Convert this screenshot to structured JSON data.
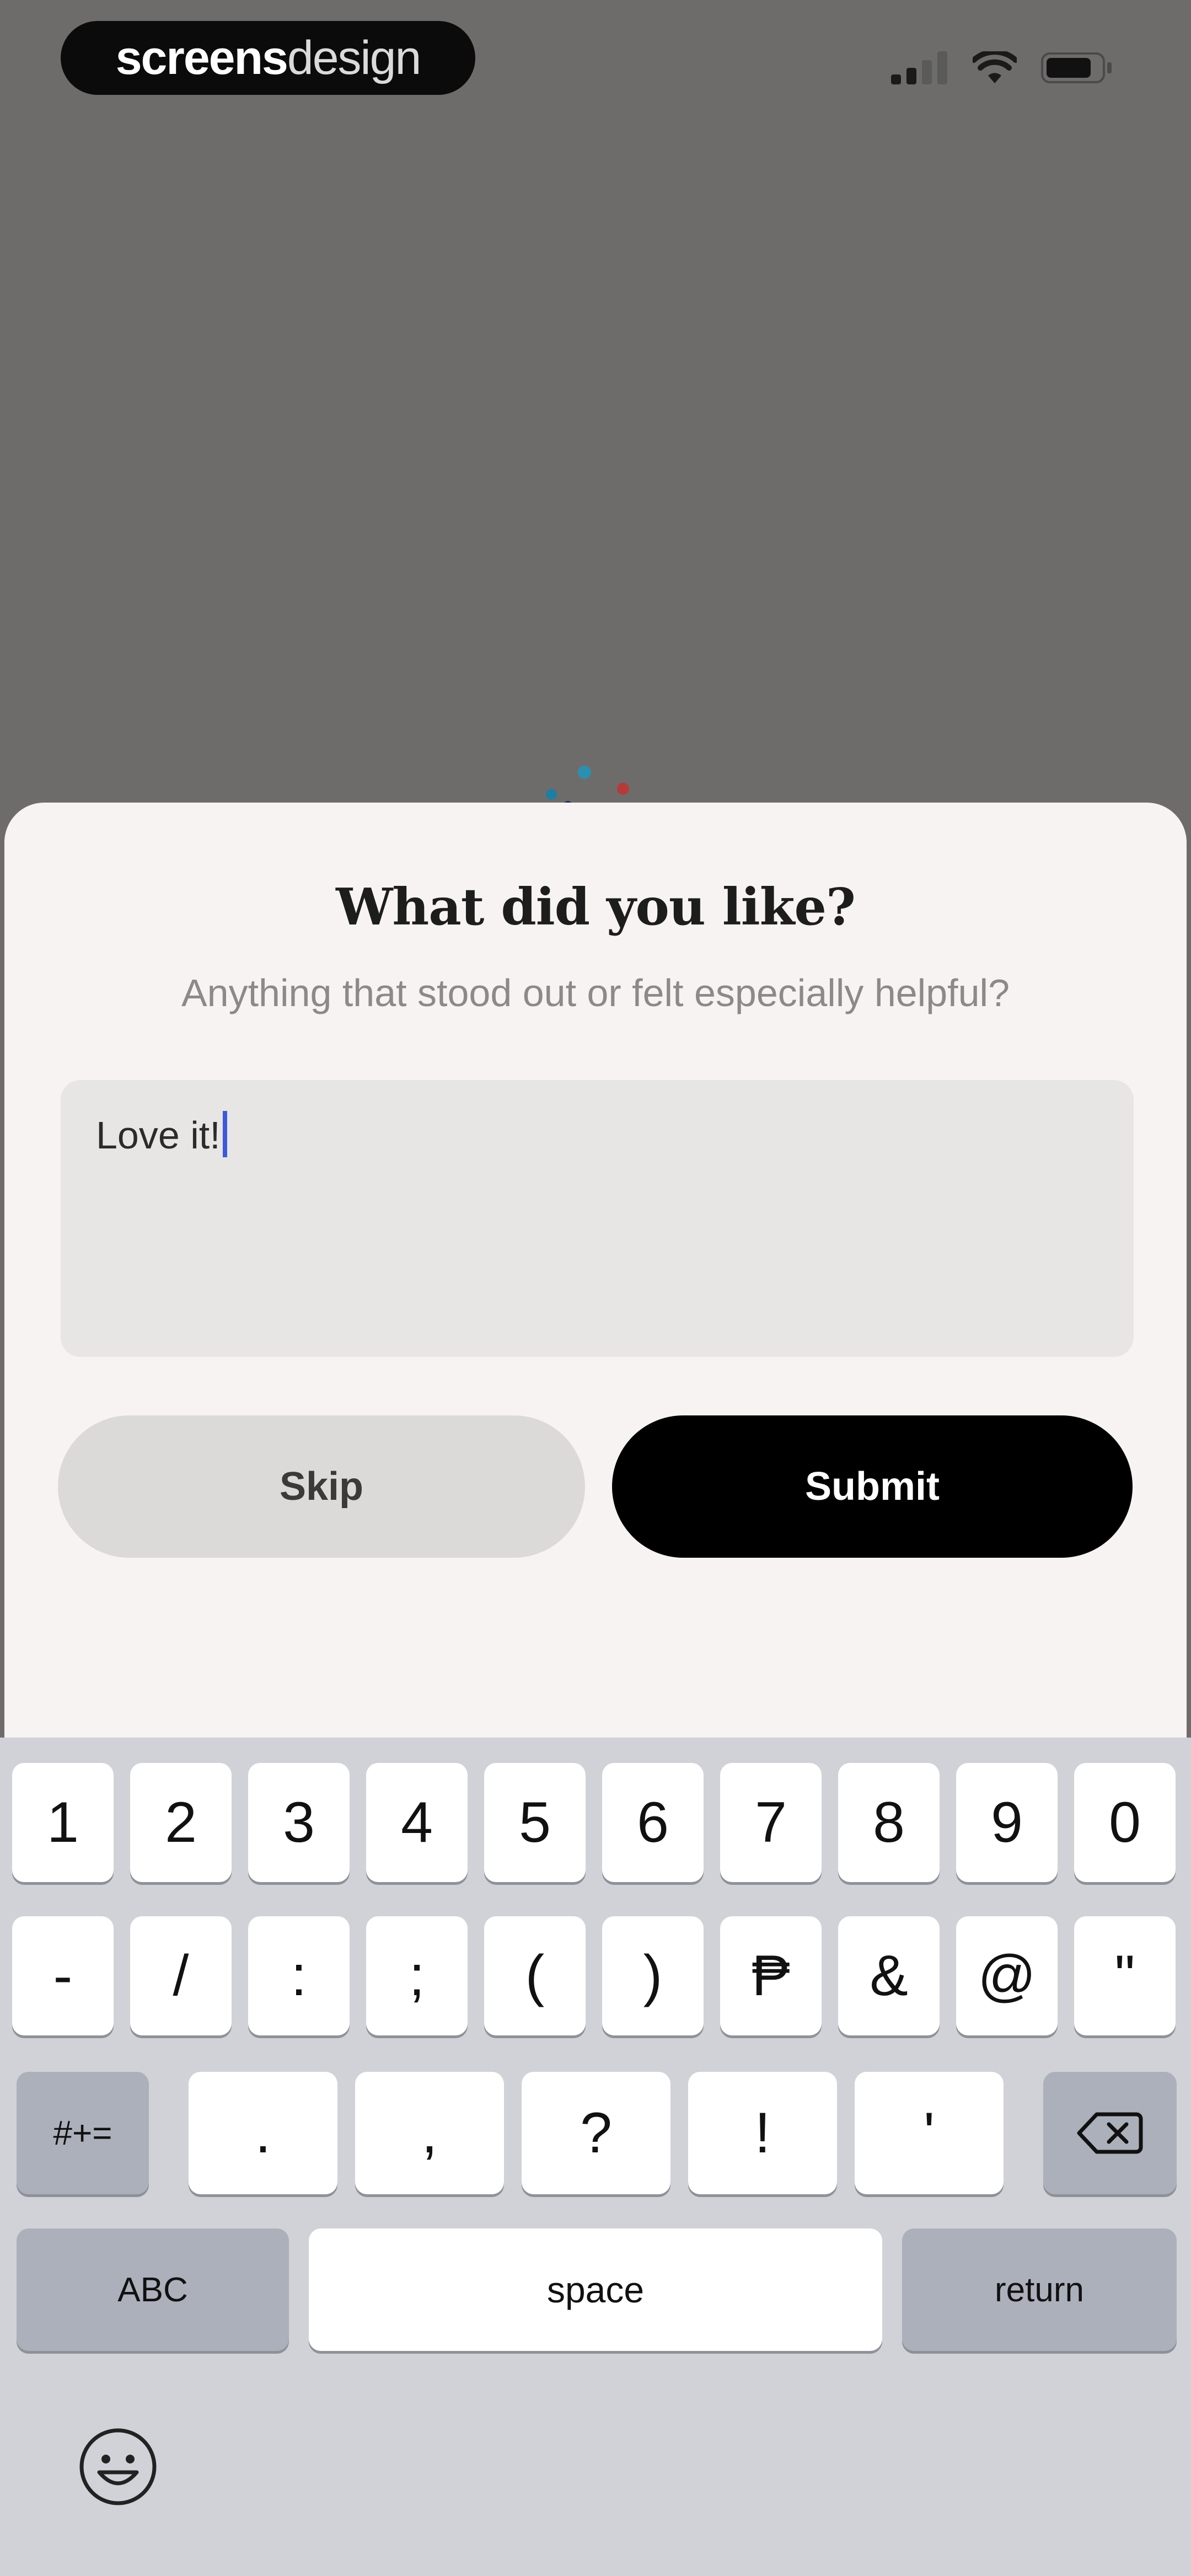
{
  "brand": {
    "strong": "screens",
    "light": "design"
  },
  "sheet": {
    "title": "What did you like?",
    "subtitle": "Anything that stood out or felt especially helpful?",
    "feedback_value": "Love it!",
    "skip_label": "Skip",
    "submit_label": "Submit"
  },
  "keyboard": {
    "row1": [
      "1",
      "2",
      "3",
      "4",
      "5",
      "6",
      "7",
      "8",
      "9",
      "0"
    ],
    "row2": [
      "-",
      "/",
      ":",
      ";",
      "(",
      ")",
      "₱",
      "&",
      "@",
      "\""
    ],
    "row3": {
      "symbols_label": "#+=",
      "keys": [
        ".",
        ",",
        "?",
        "!",
        "'"
      ]
    },
    "row4": {
      "abc_label": "ABC",
      "space_label": "space",
      "return_label": "return"
    }
  },
  "colors": {
    "backdrop": "#6e6c6b",
    "sheet": "#f7f3f2",
    "input_bg": "#e7e6e4",
    "submit_bg": "#000000",
    "skip_bg": "#dcdad8",
    "caret": "#3b5bdb",
    "keyboard_bg": "#d0d2d7"
  },
  "icons": {
    "status": [
      "cellular-signal-icon",
      "wifi-icon",
      "battery-icon"
    ],
    "keyboard": [
      "backspace-icon",
      "emoji-icon"
    ],
    "loader": "loading-dots-icon"
  }
}
